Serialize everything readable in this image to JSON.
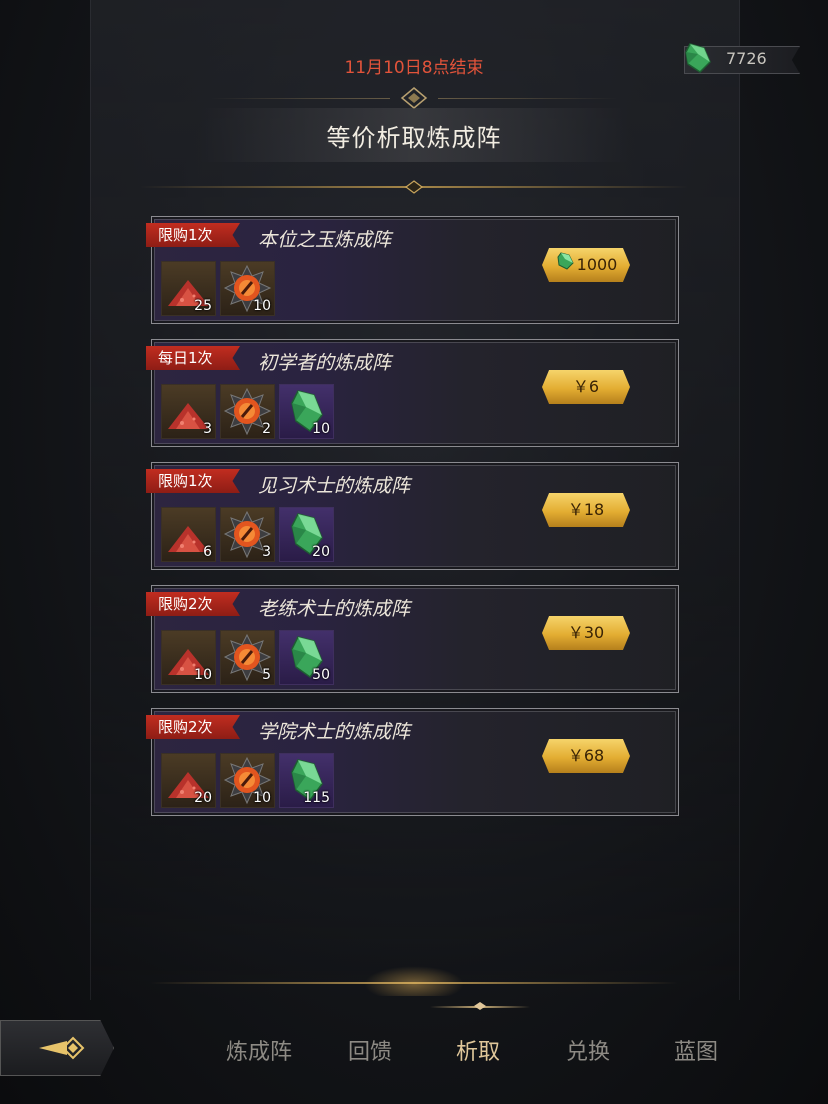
{
  "header": {
    "end_time": "11月10日8点结束",
    "currency_value": "7726",
    "title": "等价析取炼成阵"
  },
  "cards": [
    {
      "limit": "限购1次",
      "name": "本位之玉炼成阵",
      "items": [
        {
          "icon": "red-powder-icon",
          "qty": "25"
        },
        {
          "icon": "fire-orb-icon",
          "qty": "10"
        }
      ],
      "price": "1000",
      "price_icon": "green-gem-icon"
    },
    {
      "limit": "每日1次",
      "name": "初学者的炼成阵",
      "items": [
        {
          "icon": "red-powder-icon",
          "qty": "3"
        },
        {
          "icon": "fire-orb-icon",
          "qty": "2"
        },
        {
          "icon": "green-gem-icon",
          "qty": "10"
        }
      ],
      "price": "￥6"
    },
    {
      "limit": "限购1次",
      "name": "见习术士的炼成阵",
      "items": [
        {
          "icon": "red-powder-icon",
          "qty": "6"
        },
        {
          "icon": "fire-orb-icon",
          "qty": "3"
        },
        {
          "icon": "green-gem-icon",
          "qty": "20"
        }
      ],
      "price": "￥18"
    },
    {
      "limit": "限购2次",
      "name": "老练术士的炼成阵",
      "items": [
        {
          "icon": "red-powder-icon",
          "qty": "10"
        },
        {
          "icon": "fire-orb-icon",
          "qty": "5"
        },
        {
          "icon": "green-gem-icon",
          "qty": "50"
        }
      ],
      "price": "￥30"
    },
    {
      "limit": "限购2次",
      "name": "学院术士的炼成阵",
      "items": [
        {
          "icon": "red-powder-icon",
          "qty": "20"
        },
        {
          "icon": "fire-orb-icon",
          "qty": "10"
        },
        {
          "icon": "green-gem-icon",
          "qty": "115"
        }
      ],
      "price": "￥68"
    }
  ],
  "tabs": [
    {
      "label": "炼成阵",
      "active": false
    },
    {
      "label": "回馈",
      "active": false
    },
    {
      "label": "析取",
      "active": true
    },
    {
      "label": "兑换",
      "active": false
    },
    {
      "label": "蓝图",
      "active": false
    }
  ],
  "colors": {
    "end_time": "#e2533a",
    "limit_tag": "#b3271b",
    "price_gold": "#e3ad32",
    "active_tab": "#e0c79a",
    "inactive_tab": "#8d8a84"
  }
}
